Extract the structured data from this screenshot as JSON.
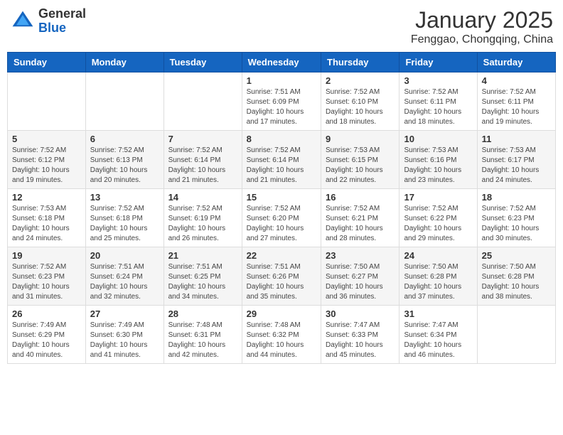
{
  "logo": {
    "general": "General",
    "blue": "Blue"
  },
  "title": "January 2025",
  "location": "Fenggao, Chongqing, China",
  "weekdays": [
    "Sunday",
    "Monday",
    "Tuesday",
    "Wednesday",
    "Thursday",
    "Friday",
    "Saturday"
  ],
  "weeks": [
    [
      {
        "day": null,
        "info": null
      },
      {
        "day": null,
        "info": null
      },
      {
        "day": null,
        "info": null
      },
      {
        "day": "1",
        "info": "Sunrise: 7:51 AM\nSunset: 6:09 PM\nDaylight: 10 hours\nand 17 minutes."
      },
      {
        "day": "2",
        "info": "Sunrise: 7:52 AM\nSunset: 6:10 PM\nDaylight: 10 hours\nand 18 minutes."
      },
      {
        "day": "3",
        "info": "Sunrise: 7:52 AM\nSunset: 6:11 PM\nDaylight: 10 hours\nand 18 minutes."
      },
      {
        "day": "4",
        "info": "Sunrise: 7:52 AM\nSunset: 6:11 PM\nDaylight: 10 hours\nand 19 minutes."
      }
    ],
    [
      {
        "day": "5",
        "info": "Sunrise: 7:52 AM\nSunset: 6:12 PM\nDaylight: 10 hours\nand 19 minutes."
      },
      {
        "day": "6",
        "info": "Sunrise: 7:52 AM\nSunset: 6:13 PM\nDaylight: 10 hours\nand 20 minutes."
      },
      {
        "day": "7",
        "info": "Sunrise: 7:52 AM\nSunset: 6:14 PM\nDaylight: 10 hours\nand 21 minutes."
      },
      {
        "day": "8",
        "info": "Sunrise: 7:52 AM\nSunset: 6:14 PM\nDaylight: 10 hours\nand 21 minutes."
      },
      {
        "day": "9",
        "info": "Sunrise: 7:53 AM\nSunset: 6:15 PM\nDaylight: 10 hours\nand 22 minutes."
      },
      {
        "day": "10",
        "info": "Sunrise: 7:53 AM\nSunset: 6:16 PM\nDaylight: 10 hours\nand 23 minutes."
      },
      {
        "day": "11",
        "info": "Sunrise: 7:53 AM\nSunset: 6:17 PM\nDaylight: 10 hours\nand 24 minutes."
      }
    ],
    [
      {
        "day": "12",
        "info": "Sunrise: 7:53 AM\nSunset: 6:18 PM\nDaylight: 10 hours\nand 24 minutes."
      },
      {
        "day": "13",
        "info": "Sunrise: 7:52 AM\nSunset: 6:18 PM\nDaylight: 10 hours\nand 25 minutes."
      },
      {
        "day": "14",
        "info": "Sunrise: 7:52 AM\nSunset: 6:19 PM\nDaylight: 10 hours\nand 26 minutes."
      },
      {
        "day": "15",
        "info": "Sunrise: 7:52 AM\nSunset: 6:20 PM\nDaylight: 10 hours\nand 27 minutes."
      },
      {
        "day": "16",
        "info": "Sunrise: 7:52 AM\nSunset: 6:21 PM\nDaylight: 10 hours\nand 28 minutes."
      },
      {
        "day": "17",
        "info": "Sunrise: 7:52 AM\nSunset: 6:22 PM\nDaylight: 10 hours\nand 29 minutes."
      },
      {
        "day": "18",
        "info": "Sunrise: 7:52 AM\nSunset: 6:23 PM\nDaylight: 10 hours\nand 30 minutes."
      }
    ],
    [
      {
        "day": "19",
        "info": "Sunrise: 7:52 AM\nSunset: 6:23 PM\nDaylight: 10 hours\nand 31 minutes."
      },
      {
        "day": "20",
        "info": "Sunrise: 7:51 AM\nSunset: 6:24 PM\nDaylight: 10 hours\nand 32 minutes."
      },
      {
        "day": "21",
        "info": "Sunrise: 7:51 AM\nSunset: 6:25 PM\nDaylight: 10 hours\nand 34 minutes."
      },
      {
        "day": "22",
        "info": "Sunrise: 7:51 AM\nSunset: 6:26 PM\nDaylight: 10 hours\nand 35 minutes."
      },
      {
        "day": "23",
        "info": "Sunrise: 7:50 AM\nSunset: 6:27 PM\nDaylight: 10 hours\nand 36 minutes."
      },
      {
        "day": "24",
        "info": "Sunrise: 7:50 AM\nSunset: 6:28 PM\nDaylight: 10 hours\nand 37 minutes."
      },
      {
        "day": "25",
        "info": "Sunrise: 7:50 AM\nSunset: 6:28 PM\nDaylight: 10 hours\nand 38 minutes."
      }
    ],
    [
      {
        "day": "26",
        "info": "Sunrise: 7:49 AM\nSunset: 6:29 PM\nDaylight: 10 hours\nand 40 minutes."
      },
      {
        "day": "27",
        "info": "Sunrise: 7:49 AM\nSunset: 6:30 PM\nDaylight: 10 hours\nand 41 minutes."
      },
      {
        "day": "28",
        "info": "Sunrise: 7:48 AM\nSunset: 6:31 PM\nDaylight: 10 hours\nand 42 minutes."
      },
      {
        "day": "29",
        "info": "Sunrise: 7:48 AM\nSunset: 6:32 PM\nDaylight: 10 hours\nand 44 minutes."
      },
      {
        "day": "30",
        "info": "Sunrise: 7:47 AM\nSunset: 6:33 PM\nDaylight: 10 hours\nand 45 minutes."
      },
      {
        "day": "31",
        "info": "Sunrise: 7:47 AM\nSunset: 6:34 PM\nDaylight: 10 hours\nand 46 minutes."
      },
      {
        "day": null,
        "info": null
      }
    ]
  ]
}
